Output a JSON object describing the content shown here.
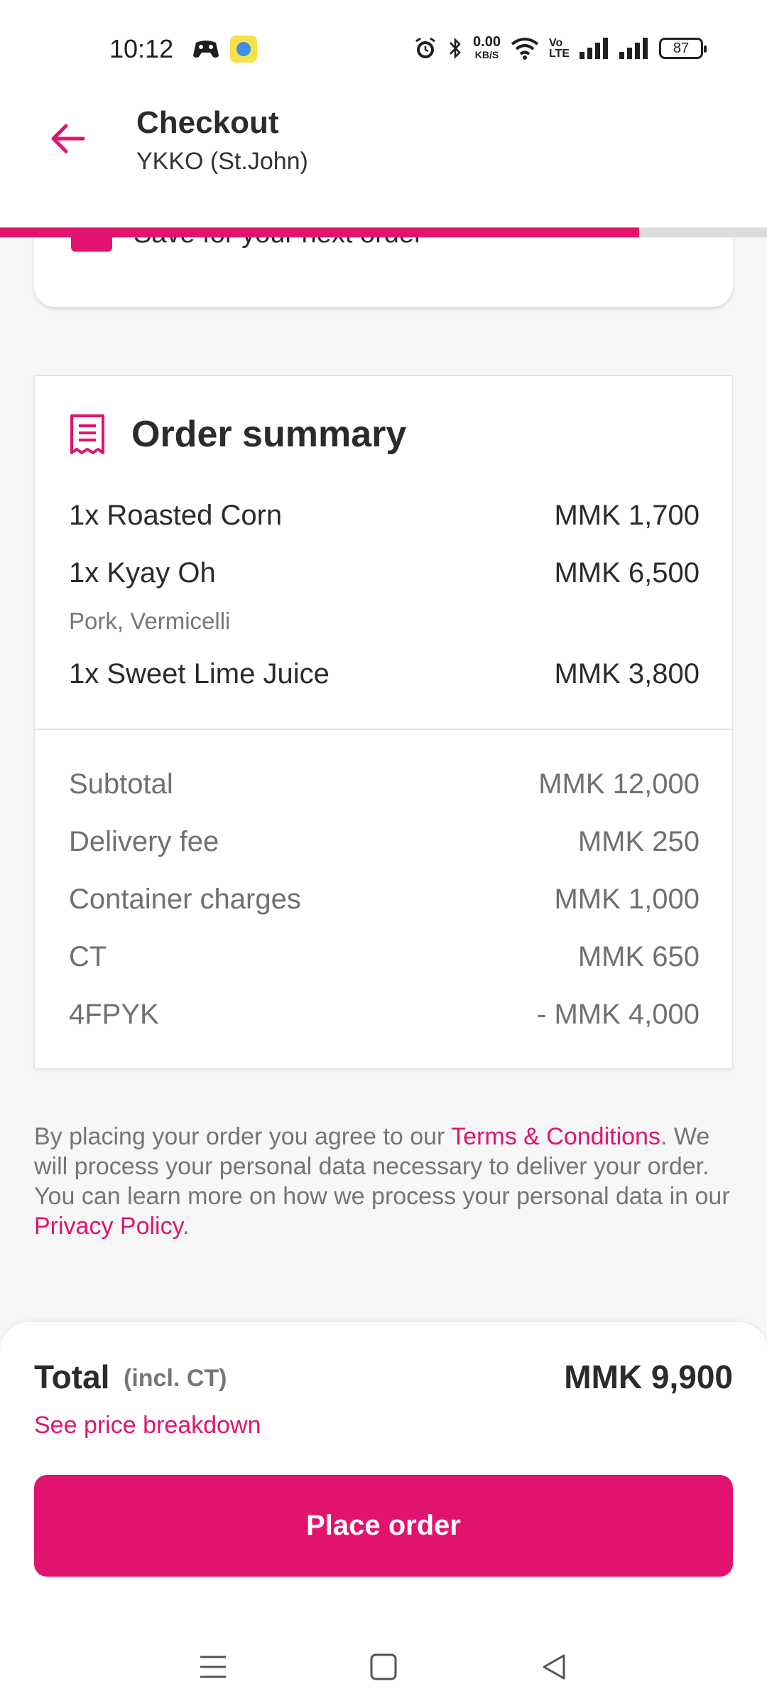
{
  "status_bar": {
    "time": "10:12",
    "net_speed_value": "0.00",
    "net_speed_unit": "KB/S",
    "volte_top": "Vo",
    "volte_bottom": "LTE",
    "battery": "87"
  },
  "header": {
    "title": "Checkout",
    "subtitle": "YKKO (St.John)",
    "progress_fraction": 0.833
  },
  "saved_card": {
    "text": "Save for your next order"
  },
  "order_summary": {
    "title": "Order summary",
    "items": [
      {
        "name": "1x Roasted Corn",
        "price": "MMK 1,700"
      },
      {
        "name": "1x Kyay Oh",
        "price": "MMK 6,500",
        "options": "Pork, Vermicelli"
      },
      {
        "name": "1x Sweet Lime Juice",
        "price": "MMK 3,800"
      }
    ],
    "fees": [
      {
        "label": "Subtotal",
        "value": "MMK 12,000"
      },
      {
        "label": "Delivery fee",
        "value": "MMK 250"
      },
      {
        "label": "Container charges",
        "value": "MMK 1,000"
      },
      {
        "label": "CT",
        "value": "MMK 650"
      },
      {
        "label": "4FPYK",
        "value": "- MMK 4,000"
      }
    ]
  },
  "legal": {
    "part1": "By placing your order you agree to our ",
    "terms_link": "Terms & Conditions",
    "part2": ". We will process your personal data necessary to deliver your order. You can learn more on how we process your personal data in our ",
    "privacy_link": "Privacy Policy",
    "part3": "."
  },
  "total": {
    "label": "Total",
    "note": "(incl. CT)",
    "value": "MMK 9,900",
    "breakdown_link": "See price breakdown"
  },
  "place_order_label": "Place order",
  "colors": {
    "accent": "#e2136e",
    "text": "#2b2b2b",
    "muted": "#707070"
  }
}
